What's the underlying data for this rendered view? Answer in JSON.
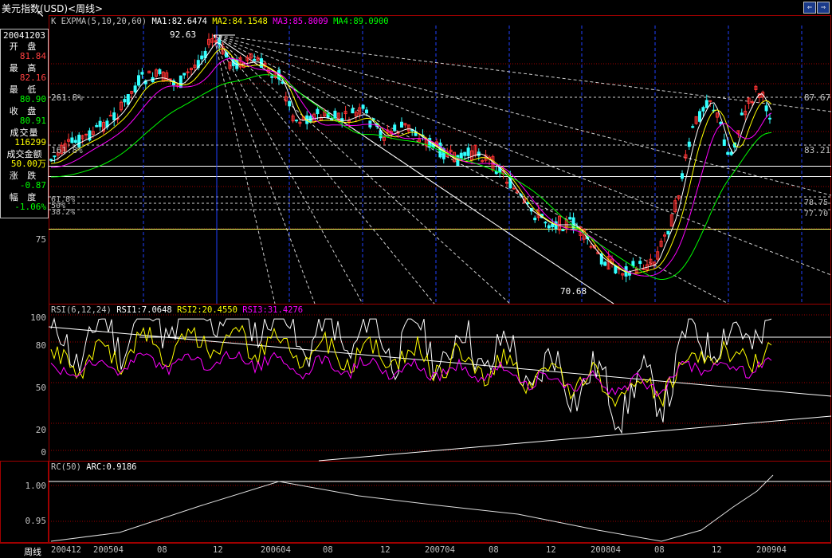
{
  "title": "美元指数(USD)<周线>",
  "nav": {
    "prev": "⇐",
    "next": "⇒"
  },
  "colors": {
    "up": "#ff3333",
    "down": "#33ffff",
    "ma1": "#ffffff",
    "ma2": "#ffff00",
    "ma3": "#ff00ff",
    "ma4": "#00ff00",
    "grid": "#a00000"
  },
  "info": {
    "date": "20041203",
    "open_label": "开 盘",
    "open": "81.84",
    "high_label": "最 高",
    "high": "82.16",
    "low_label": "最 低",
    "low": "80.90",
    "close_label": "收 盘",
    "close": "80.91",
    "volume_label": "成交量",
    "volume": "116299",
    "amount_label": "成交金额",
    "amount": "50.00万",
    "change_label": "涨 跌",
    "change": "-0.87",
    "range_label": "幅 度",
    "range": "-1.06%"
  },
  "main_header": {
    "indicator": "K  EXPMA(5,10,20,60)",
    "ma1": "MA1:82.6474",
    "ma2": "MA2:84.1548",
    "ma3": "MA3:85.8009",
    "ma4": "MA4:89.0900"
  },
  "main_annotations": {
    "peak": "92.63",
    "trough": "70.68",
    "fib_261": "261.8%",
    "fib_161": "161.8%",
    "fib_61": "61.8%",
    "fib_50": "50%",
    "fib_38": "38.2%"
  },
  "main_right_labels": {
    "r1": "87.67",
    "r2": "83.21",
    "r3": "78.75",
    "r4": "77.70"
  },
  "main_axis": {
    "y75": "75"
  },
  "rsi_header": {
    "name": "RSI(6,12,24)",
    "rsi1": "RSI1:7.0648",
    "rsi2": "RSI2:20.4550",
    "rsi3": "RSI3:31.4276"
  },
  "rsi_axis": {
    "y100": "100",
    "y80": "80",
    "y50": "50",
    "y20": "20",
    "y0": "0"
  },
  "rc_header": {
    "name": "RC(50)",
    "arc": "ARC:0.9186"
  },
  "rc_axis": {
    "y100": "1.00",
    "y95": "0.95"
  },
  "period": "周线",
  "x_labels": [
    "200412",
    "200504",
    "08",
    "12",
    "200604",
    "08",
    "12",
    "200704",
    "08",
    "12",
    "200804",
    "08",
    "12",
    "200904"
  ],
  "chart_data": {
    "type": "line",
    "title": "美元指数(USD)<周线>",
    "x_ticks": [
      "200412",
      "200504",
      "08",
      "12",
      "200604",
      "08",
      "12",
      "200704",
      "08",
      "12",
      "200804",
      "08",
      "12",
      "200904"
    ],
    "series": [
      {
        "name": "MA1",
        "values": [
          81.0,
          83.5,
          88.0,
          91.5,
          88.0,
          85.5,
          85.5,
          83.0,
          80.5,
          76.5,
          74.0,
          72.0,
          86.5,
          85.0
        ]
      },
      {
        "name": "MA4",
        "values": [
          85.5,
          84.0,
          85.5,
          88.5,
          88.0,
          87.0,
          86.0,
          84.5,
          82.0,
          79.5,
          76.5,
          75.0,
          78.5,
          81.0
        ]
      }
    ],
    "rsi_series": [
      {
        "name": "RSI1",
        "values": [
          35,
          60,
          85,
          70,
          45,
          40,
          55,
          40,
          55,
          30,
          40,
          35,
          85,
          7
        ]
      },
      {
        "name": "RSI3",
        "values": [
          45,
          50,
          62,
          58,
          48,
          47,
          50,
          48,
          48,
          42,
          45,
          45,
          68,
          31
        ]
      }
    ],
    "rc_series": {
      "name": "RC",
      "values": [
        0.92,
        0.95,
        0.98,
        1.005,
        0.99,
        0.98,
        0.97,
        0.955,
        0.95,
        0.945,
        0.93,
        0.92,
        0.96,
        1.02
      ]
    }
  }
}
